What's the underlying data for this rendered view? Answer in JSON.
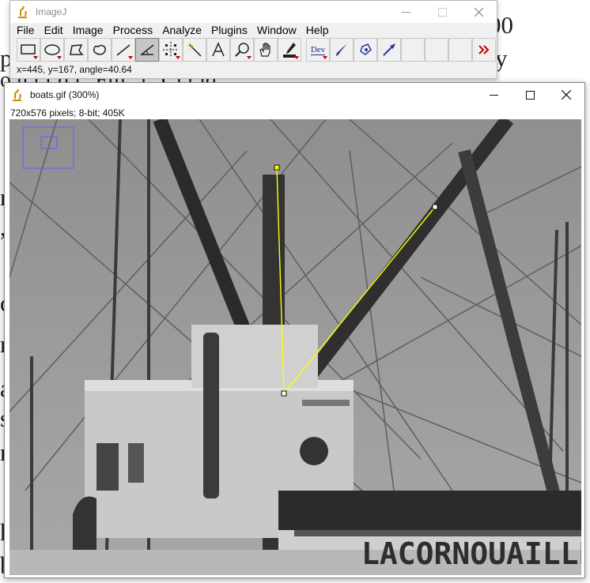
{
  "main_window": {
    "title": "ImageJ",
    "menus": [
      "File",
      "Edit",
      "Image",
      "Process",
      "Analyze",
      "Plugins",
      "Window",
      "Help"
    ],
    "dev_label": "Dev",
    "status": "x=445, y=167, angle=40.64"
  },
  "tools": [
    {
      "name": "rectangle-tool",
      "icon": "rectangle-icon"
    },
    {
      "name": "oval-tool",
      "icon": "oval-icon"
    },
    {
      "name": "polygon-tool",
      "icon": "polygon-icon"
    },
    {
      "name": "freehand-tool",
      "icon": "freehand-icon"
    },
    {
      "name": "line-tool",
      "icon": "line-icon"
    },
    {
      "name": "angle-tool",
      "icon": "angle-icon"
    },
    {
      "name": "point-tool",
      "icon": "point-icon"
    },
    {
      "name": "wand-tool",
      "icon": "wand-icon"
    },
    {
      "name": "text-tool",
      "icon": "text-icon"
    },
    {
      "name": "magnifier-tool",
      "icon": "magnifier-icon"
    },
    {
      "name": "hand-tool",
      "icon": "hand-icon"
    },
    {
      "name": "color-picker-tool",
      "icon": "dropper-icon"
    },
    {
      "name": "dev-tool",
      "icon": "dev-icon"
    },
    {
      "name": "brush-tool",
      "icon": "brush-icon"
    },
    {
      "name": "flood-fill-tool",
      "icon": "fill-icon"
    },
    {
      "name": "arrow-tool",
      "icon": "arrow-icon"
    },
    {
      "name": "empty-slot-1",
      "icon": ""
    },
    {
      "name": "empty-slot-2",
      "icon": ""
    },
    {
      "name": "empty-slot-3",
      "icon": ""
    },
    {
      "name": "more-tools",
      "icon": "double-chevron-icon"
    }
  ],
  "image_window": {
    "title": "boats.gif (300%)",
    "info": "720x576 pixels; 8-bit; 405K",
    "boat_name": "LACORNOUAILLE",
    "angle_roi_color": "#ffff00"
  },
  "background_text": {
    "frag1": "0",
    "frag2": "pi",
    "frag3": "y",
    "frag4": "o     h       i f   d  i   \"Fill\" i  \"Cl        t  id  \"",
    "frag5": "n",
    "frag6": ",",
    "frag7": "c",
    "frag8": "r",
    "frag9": "a",
    "frag10": "s",
    "frag11": "n",
    "frag12": "h",
    "frag13": "b",
    "frag14": "00"
  }
}
